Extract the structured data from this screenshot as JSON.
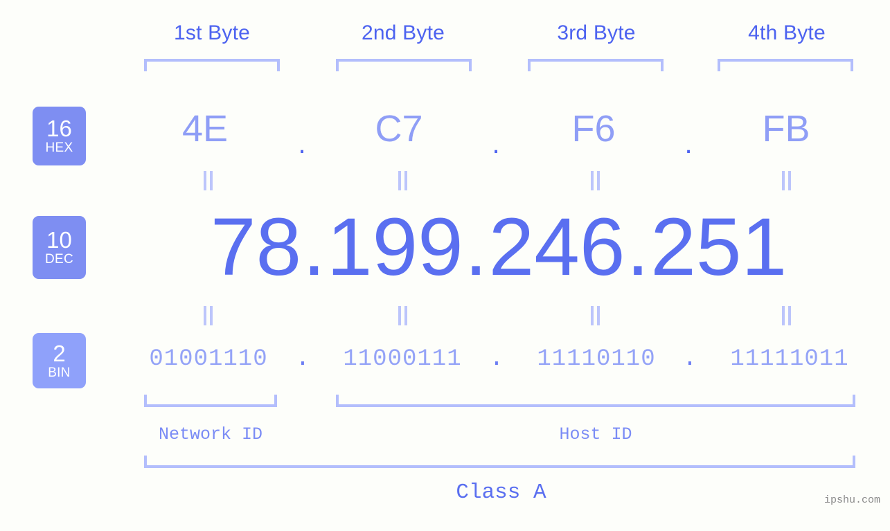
{
  "background_color": "#fdfefa",
  "colors": {
    "header_blue": "#4d63f0",
    "bracket": "#b3befc",
    "badge_primary": "#7e8ef2",
    "badge_bin": "#8fa1fa",
    "hex_text": "#8f9ef6",
    "dec_text": "#5a6ff0",
    "bin_text": "#94a3f7",
    "section_label": "#7b8cf5",
    "watermark": "#8a8a8a"
  },
  "byte_headers": [
    {
      "label": "1st Byte"
    },
    {
      "label": "2nd Byte"
    },
    {
      "label": "3rd Byte"
    },
    {
      "label": "4th Byte"
    }
  ],
  "bases": [
    {
      "id": "hex",
      "number": "16",
      "abbr": "HEX"
    },
    {
      "id": "dec",
      "number": "10",
      "abbr": "DEC"
    },
    {
      "id": "bin",
      "number": "2",
      "abbr": "BIN"
    }
  ],
  "separator": ".",
  "equals_sign": "=",
  "rows": {
    "hex": {
      "values": [
        "4E",
        "C7",
        "F6",
        "FB"
      ]
    },
    "dec": {
      "values": [
        "78",
        "199",
        "246",
        "251"
      ]
    },
    "bin": {
      "values": [
        "01001110",
        "11000111",
        "11110110",
        "11111011"
      ]
    }
  },
  "segments": {
    "network_id": "Network ID",
    "host_id": "Host ID"
  },
  "class_label": "Class A",
  "watermark": "ipshu.com"
}
